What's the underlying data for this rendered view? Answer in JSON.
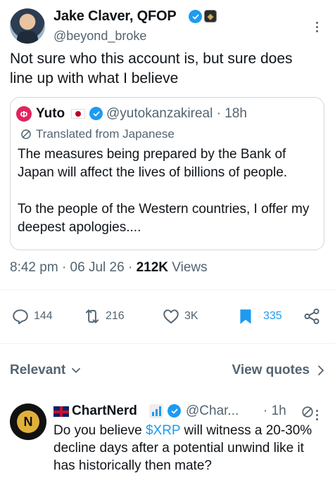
{
  "post": {
    "author_name": "Jake Claver, QFOP",
    "author_handle": "@beyond_broke",
    "text": "Not sure who this account is, but sure does line up with what I believe"
  },
  "quote": {
    "name": "Yuto",
    "handle": "@yutokanzakireal",
    "time": "· 18h",
    "translated_label": "Translated from Japanese",
    "paragraph1": "The measures being prepared by the Bank of Japan will affect the lives of billions of people.",
    "paragraph2": "To the people of the Western countries, I offer my deepest apologies...."
  },
  "meta": {
    "time": "8:42 pm",
    "date": "06 Jul 26",
    "views_count": "212K",
    "views_label": "Views"
  },
  "actions": {
    "replies": "144",
    "reposts": "216",
    "likes": "3K",
    "bookmarks": "335"
  },
  "filters": {
    "relevant_label": "Relevant",
    "view_quotes_label": "View quotes"
  },
  "reply": {
    "name": "ChartNerd",
    "handle": "@Char...",
    "time": "· 1h",
    "text_before": "Do you believe ",
    "cashtag": "$XRP",
    "text_after": " will witness a 20-30% decline days after a potential unwind like it has historically then mate?"
  },
  "colors": {
    "accent": "#1d9bf0",
    "secondary_text": "#536471",
    "border": "#cfd9de"
  },
  "icons": [
    "verified-badge-icon",
    "more-icon",
    "translate-icon",
    "reply-icon",
    "repost-icon",
    "like-icon",
    "bookmark-icon",
    "share-icon",
    "chevron-down-icon",
    "chevron-right-icon"
  ]
}
